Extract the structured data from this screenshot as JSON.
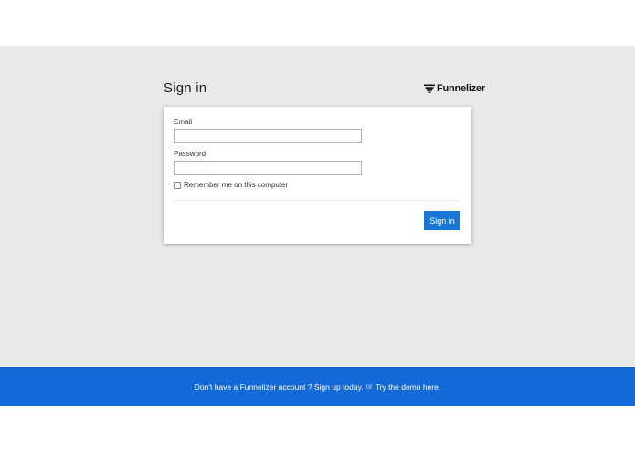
{
  "page": {
    "title": "Sign in"
  },
  "brand": {
    "logo_text": "Funnelizer",
    "logo_icon": "funnel-stack-icon"
  },
  "form": {
    "email_label": "Email",
    "email_value": "",
    "password_label": "Password",
    "password_value": "",
    "remember_label": "Remember me on this computer",
    "remember_checked": false,
    "submit_label": "Sign in"
  },
  "footer": {
    "prompt": "Don't have a Funnelizer account ?",
    "signup_link": "Sign up today.",
    "or_text": "or",
    "demo_link": "Try the demo here."
  },
  "colors": {
    "background_gray": "#e9e9e9",
    "primary_button": "#1a77d6",
    "footer_bar": "#1469d9"
  }
}
